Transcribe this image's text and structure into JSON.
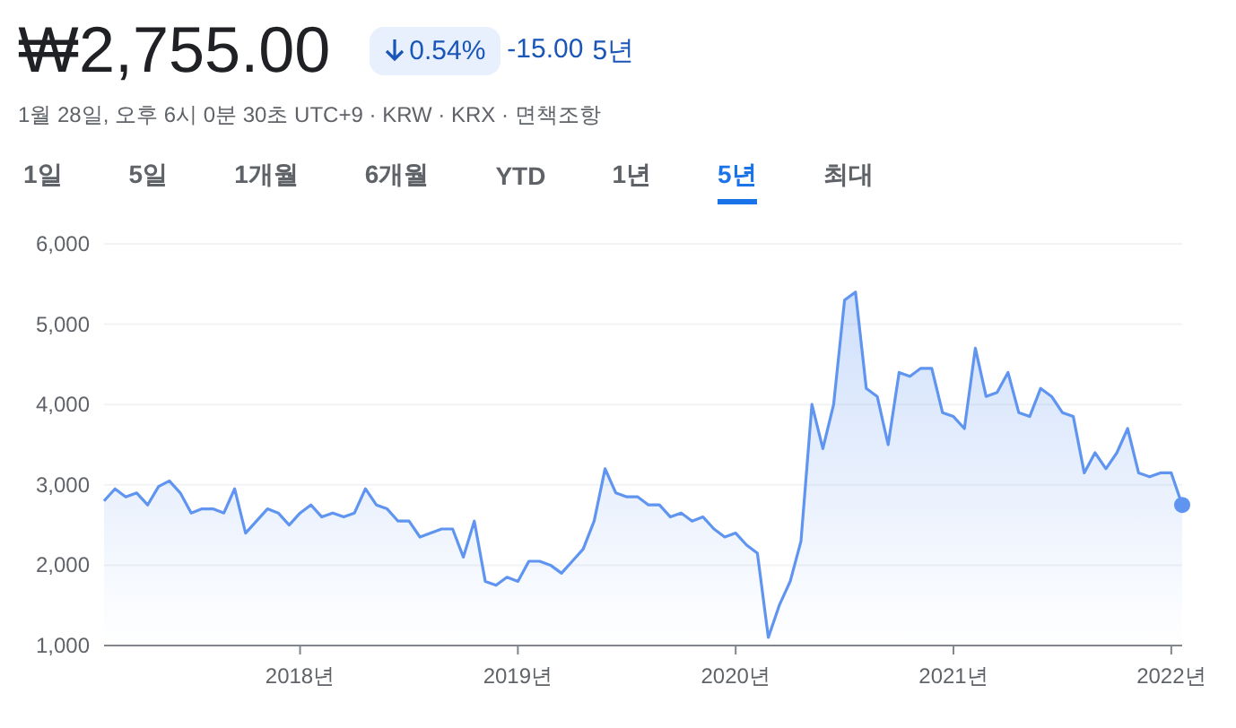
{
  "quote": {
    "price": "₩2,755.00",
    "change_percent": "0.54%",
    "change_value": "-15.00",
    "period": "5년",
    "meta": "1월 28일, 오후 6시 0분 30초 UTC+9 · KRW · KRX · ",
    "disclaimer_link": "면책조항"
  },
  "tabs": [
    {
      "label": "1일",
      "selected": false
    },
    {
      "label": "5일",
      "selected": false
    },
    {
      "label": "1개월",
      "selected": false
    },
    {
      "label": "6개월",
      "selected": false
    },
    {
      "label": "YTD",
      "selected": false
    },
    {
      "label": "1년",
      "selected": false
    },
    {
      "label": "5년",
      "selected": true
    },
    {
      "label": "최대",
      "selected": false
    }
  ],
  "chart": {
    "chart_data": {
      "type": "area",
      "grid": true,
      "xlim": [
        2017.1,
        2022.05
      ],
      "ylim": [
        1000,
        6000
      ],
      "yticks": [
        {
          "value": 1000,
          "label": "1,000"
        },
        {
          "value": 2000,
          "label": "2,000"
        },
        {
          "value": 3000,
          "label": "3,000"
        },
        {
          "value": 4000,
          "label": "4,000"
        },
        {
          "value": 5000,
          "label": "5,000"
        },
        {
          "value": 6000,
          "label": "6,000"
        }
      ],
      "xticks": [
        {
          "value": 2018,
          "label": "2018년"
        },
        {
          "value": 2019,
          "label": "2019년"
        },
        {
          "value": 2020,
          "label": "2020년"
        },
        {
          "value": 2021,
          "label": "2021년"
        },
        {
          "value": 2022,
          "label": "2022년"
        }
      ],
      "x": [
        2017.1,
        2017.15,
        2017.2,
        2017.25,
        2017.3,
        2017.35,
        2017.4,
        2017.45,
        2017.5,
        2017.55,
        2017.6,
        2017.65,
        2017.7,
        2017.75,
        2017.8,
        2017.85,
        2017.9,
        2017.95,
        2018,
        2018.05,
        2018.1,
        2018.15,
        2018.2,
        2018.25,
        2018.3,
        2018.35,
        2018.4,
        2018.45,
        2018.5,
        2018.55,
        2018.6,
        2018.65,
        2018.7,
        2018.75,
        2018.8,
        2018.85,
        2018.9,
        2018.95,
        2019,
        2019.05,
        2019.1,
        2019.15,
        2019.2,
        2019.25,
        2019.3,
        2019.35,
        2019.4,
        2019.45,
        2019.5,
        2019.55,
        2019.6,
        2019.65,
        2019.7,
        2019.75,
        2019.8,
        2019.85,
        2019.9,
        2019.95,
        2020,
        2020.05,
        2020.1,
        2020.15,
        2020.2,
        2020.25,
        2020.3,
        2020.35,
        2020.4,
        2020.45,
        2020.5,
        2020.55,
        2020.6,
        2020.65,
        2020.7,
        2020.75,
        2020.8,
        2020.85,
        2020.9,
        2020.95,
        2021,
        2021.05,
        2021.1,
        2021.15,
        2021.2,
        2021.25,
        2021.3,
        2021.35,
        2021.4,
        2021.45,
        2021.5,
        2021.55,
        2021.6,
        2021.65,
        2021.7,
        2021.75,
        2021.8,
        2021.85,
        2021.9,
        2021.95,
        2022,
        2022.05
      ],
      "series": [
        {
          "color": "#5f95f0",
          "values": [
            2800,
            2950,
            2850,
            2900,
            2750,
            2980,
            3050,
            2900,
            2650,
            2700,
            2700,
            2650,
            2950,
            2400,
            2550,
            2700,
            2650,
            2500,
            2650,
            2750,
            2600,
            2650,
            2600,
            2650,
            2950,
            2750,
            2700,
            2550,
            2550,
            2350,
            2400,
            2450,
            2450,
            2100,
            2550,
            1800,
            1750,
            1850,
            1800,
            2050,
            2050,
            2000,
            1900,
            2050,
            2200,
            2550,
            3200,
            2900,
            2850,
            2850,
            2750,
            2750,
            2600,
            2650,
            2550,
            2600,
            2450,
            2350,
            2400,
            2250,
            2150,
            1100,
            1500,
            1800,
            2300,
            4000,
            3450,
            4000,
            5300,
            5400,
            4200,
            4100,
            3500,
            4400,
            4350,
            4450,
            4450,
            3900,
            3850,
            3700,
            4700,
            4100,
            4150,
            4400,
            3900,
            3850,
            4200,
            4100,
            3900,
            3850,
            3150,
            3400,
            3200,
            3400,
            3700,
            3150,
            3100,
            3150,
            3150,
            2750
          ]
        }
      ]
    }
  }
}
